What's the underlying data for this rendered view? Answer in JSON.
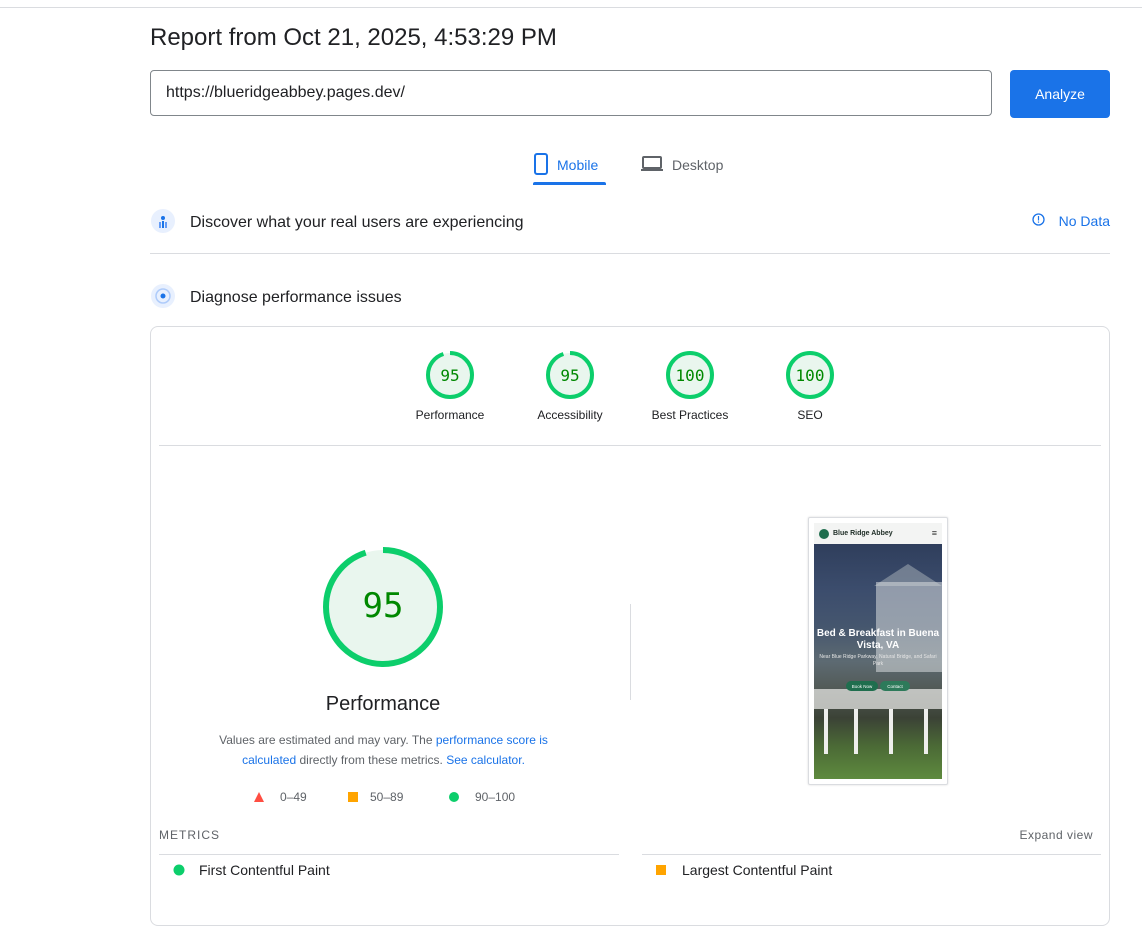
{
  "report": {
    "title": "Report from Oct 21, 2025, 4:53:29 PM"
  },
  "url_bar": {
    "value": "https://blueridgeabbey.pages.dev/",
    "analyze_label": "Analyze"
  },
  "tabs": [
    {
      "label": "Mobile",
      "selected": true
    },
    {
      "label": "Desktop",
      "selected": false
    }
  ],
  "crux": {
    "title": "Discover what your real users are experiencing",
    "status": "No Data"
  },
  "diagnose": {
    "title": "Diagnose performance issues"
  },
  "scores": [
    {
      "label": "Performance",
      "score": "95"
    },
    {
      "label": "Accessibility",
      "score": "95"
    },
    {
      "label": "Best Practices",
      "score": "100"
    },
    {
      "label": "SEO",
      "score": "100"
    }
  ],
  "performance": {
    "score": "95",
    "title": "Performance",
    "desc_pre": "Values are estimated and may vary. The ",
    "desc_link1": "performance score is calculated",
    "desc_mid": " directly from these metrics. ",
    "desc_link2": "See calculator."
  },
  "legend": [
    {
      "label": "0–49",
      "shape": "triangle"
    },
    {
      "label": "50–89",
      "shape": "square"
    },
    {
      "label": "90–100",
      "shape": "circle"
    }
  ],
  "screenshot": {
    "brand": "Blue Ridge Abbey",
    "headline": "Bed & Breakfast in Buena Vista, VA",
    "subtext": "Near Blue Ridge Parkway, Natural Bridge, and Safari Park",
    "btn1": "Book Now",
    "btn2": "Contact"
  },
  "metrics": {
    "label": "METRICS",
    "expand_label": "Expand view",
    "items": [
      {
        "label": "First Contentful Paint",
        "status": "good"
      },
      {
        "label": "Largest Contentful Paint",
        "status": "average"
      }
    ]
  },
  "colors": {
    "accent": "#1a73e8",
    "good": "#0cce6b",
    "good_text": "#008800",
    "average": "#ffa400",
    "fail": "#ff4e42",
    "gauge_fill": "#e9f6ee"
  }
}
